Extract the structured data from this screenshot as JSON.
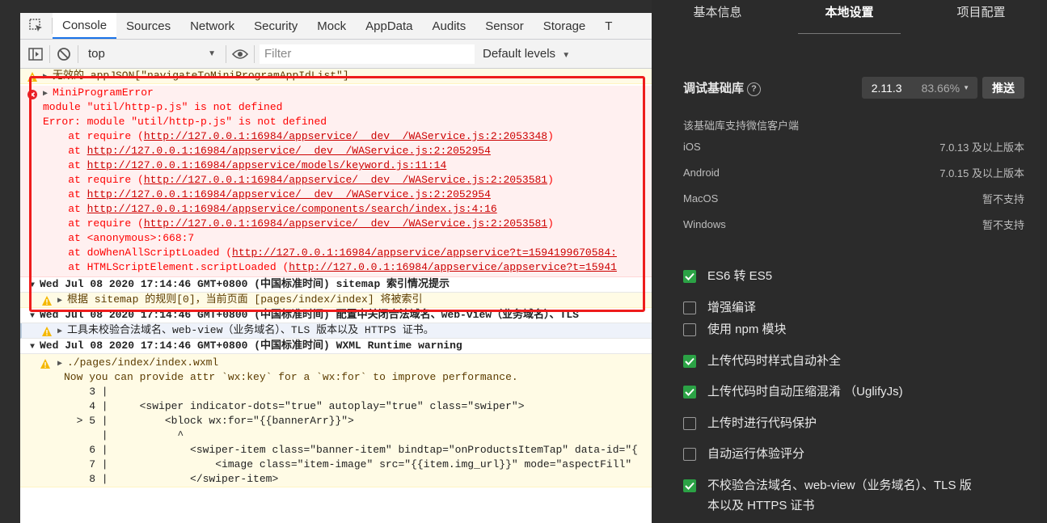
{
  "devtools": {
    "tabs": [
      "Console",
      "Sources",
      "Network",
      "Security",
      "Mock",
      "AppData",
      "Audits",
      "Sensor",
      "Storage",
      "T"
    ],
    "active_tab": "Console",
    "context": "top",
    "filter_placeholder": "Filter",
    "levels": "Default levels"
  },
  "console": {
    "warn1": "无效的 appJSON[\"navigateToMiniProgramAppIdList\"]",
    "error_title": "MiniProgramError",
    "error_lines": [
      "module \"util/http-p.js\" is not defined",
      "Error: module \"util/http-p.js\" is not defined"
    ],
    "stack": [
      {
        "pre": "    at require (",
        "link": "http://127.0.0.1:16984/appservice/__dev__/WAService.js:2:2053348",
        "post": ")"
      },
      {
        "pre": "    at ",
        "link": "http://127.0.0.1:16984/appservice/__dev__/WAService.js:2:2052954",
        "post": ""
      },
      {
        "pre": "    at ",
        "link": "http://127.0.0.1:16984/appservice/models/keyword.js:11:14",
        "post": ""
      },
      {
        "pre": "    at require (",
        "link": "http://127.0.0.1:16984/appservice/__dev__/WAService.js:2:2053581",
        "post": ")"
      },
      {
        "pre": "    at ",
        "link": "http://127.0.0.1:16984/appservice/__dev__/WAService.js:2:2052954",
        "post": ""
      },
      {
        "pre": "    at ",
        "link": "http://127.0.0.1:16984/appservice/components/search/index.js:4:16",
        "post": ""
      },
      {
        "pre": "    at require (",
        "link": "http://127.0.0.1:16984/appservice/__dev__/WAService.js:2:2053581",
        "post": ")"
      },
      {
        "pre": "    at <anonymous>:668:7",
        "link": "",
        "post": ""
      },
      {
        "pre": "    at doWhenAllScriptLoaded (",
        "link": "http://127.0.0.1:16984/appservice/appservice?t=1594199670584:",
        "post": ""
      },
      {
        "pre": "    at HTMLScriptElement.scriptLoaded (",
        "link": "http://127.0.0.1:16984/appservice/appservice?t=15941",
        "post": ""
      }
    ],
    "group1": "Wed Jul 08 2020 17:14:46 GMT+0800 (中国标准时间) sitemap 索引情况提示",
    "warn2": "根据 sitemap 的规则[0]，当前页面 [pages/index/index] 将被索引",
    "group2": "Wed Jul 08 2020 17:14:46 GMT+0800 (中国标准时间) 配置中关闭合法域名、web-view（业务域名）、TLS",
    "info1": "工具未校验合法域名、web-view（业务域名）、TLS 版本以及 HTTPS 证书。",
    "group3": "Wed Jul 08 2020 17:14:46 GMT+0800 (中国标准时间) WXML Runtime warning",
    "warn3_path": "./pages/index/index.wxml",
    "warn3_msg": "Now you can provide attr `wx:key` for a `wx:for` to improve performance.",
    "code": [
      "    3 |",
      "    4 |     <swiper indicator-dots=\"true\" autoplay=\"true\" class=\"swiper\">",
      "  > 5 |         <block wx:for=\"{{bannerArr}}\">",
      "      |           ^",
      "    6 |             <swiper-item class=\"banner-item\" bindtap=\"onProductsItemTap\" data-id=\"{",
      "    7 |                 <image class=\"item-image\" src=\"{{item.img_url}}\" mode=\"aspectFill\"",
      "    8 |             </swiper-item>"
    ]
  },
  "settings": {
    "tabs": [
      "基本信息",
      "本地设置",
      "项目配置"
    ],
    "active_tab": "本地设置",
    "lib_label": "调试基础库",
    "lib_version": "2.11.3",
    "lib_percent": "83.66%",
    "push": "推送",
    "support_note": "该基础库支持微信客户端",
    "platforms": [
      {
        "name": "iOS",
        "value": "7.0.13 及以上版本"
      },
      {
        "name": "Android",
        "value": "7.0.15 及以上版本"
      },
      {
        "name": "MacOS",
        "value": "暂不支持"
      },
      {
        "name": "Windows",
        "value": "暂不支持"
      }
    ],
    "options": [
      {
        "label": "ES6 转 ES5",
        "checked": true
      },
      {
        "label": "增强编译",
        "checked": false
      },
      {
        "label": "使用 npm 模块",
        "checked": false
      },
      {
        "label": "上传代码时样式自动补全",
        "checked": true
      },
      {
        "label": "上传代码时自动压缩混淆 （UglifyJs)",
        "checked": true
      },
      {
        "label": "上传时进行代码保护",
        "checked": false
      },
      {
        "label": "自动运行体验评分",
        "checked": false
      },
      {
        "label": "不校验合法域名、web-view（业务域名）、TLS 版",
        "label2": "本以及 HTTPS 证书",
        "checked": true
      }
    ],
    "colors": {
      "checked": "#2ba245",
      "error": "#fe0000",
      "highlight": "#ee1c1c"
    }
  }
}
